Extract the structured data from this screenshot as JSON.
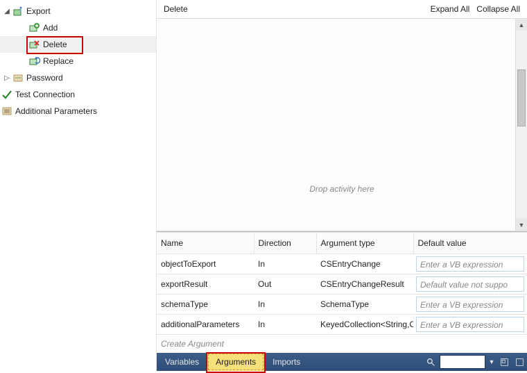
{
  "tree": {
    "export": {
      "label": "Export",
      "twisty": "◢"
    },
    "add": {
      "label": "Add"
    },
    "delete": {
      "label": "Delete"
    },
    "replace": {
      "label": "Replace"
    },
    "password": {
      "label": "Password",
      "twisty": "▷"
    },
    "testconn": {
      "label": "Test Connection"
    },
    "addlparams": {
      "label": "Additional Parameters"
    }
  },
  "designer": {
    "title": "Delete",
    "expand_all": "Expand All",
    "collapse_all": "Collapse All",
    "drop_hint": "Drop activity here"
  },
  "args": {
    "headers": {
      "name": "Name",
      "direction": "Direction",
      "type": "Argument type",
      "default": "Default value"
    },
    "rows": [
      {
        "name": "objectToExport",
        "direction": "In",
        "type": "CSEntryChange",
        "default": "Enter a VB expression"
      },
      {
        "name": "exportResult",
        "direction": "Out",
        "type": "CSEntryChangeResult",
        "default": "Default value not suppo"
      },
      {
        "name": "schemaType",
        "direction": "In",
        "type": "SchemaType",
        "default": "Enter a VB expression"
      },
      {
        "name": "additionalParameters",
        "direction": "In",
        "type": "KeyedCollection<String,Con",
        "default": "Enter a VB expression"
      }
    ],
    "create_label": "Create Argument"
  },
  "bottom": {
    "variables": "Variables",
    "arguments": "Arguments",
    "imports": "Imports"
  }
}
